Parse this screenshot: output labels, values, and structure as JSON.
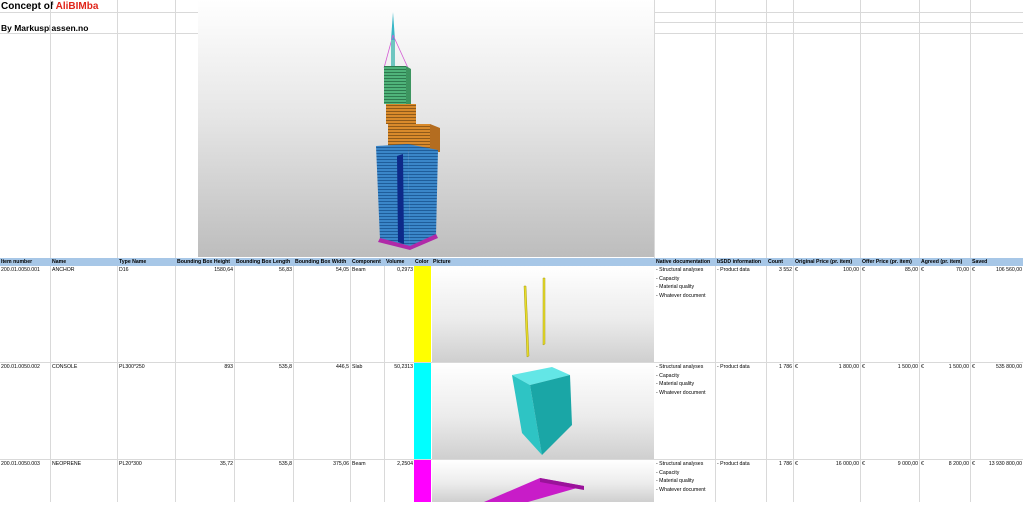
{
  "sheet": {
    "title_prefix": "Concept of ",
    "title_brand": "AliBIMba",
    "byline": "By Markusplassen.no"
  },
  "colors": {
    "header_bg": "#a7c7e7",
    "brand": "#e0251b",
    "row_colors": [
      "#ffff00",
      "#00ffff",
      "#ff00ff"
    ]
  },
  "table": {
    "columns": [
      "Item number",
      "Name",
      "Type Name",
      "Bounding Box Height",
      "Bounding Box Length",
      "Bounding Box Width",
      "Component",
      "Volume",
      "Color",
      "Picture",
      "Native documentation",
      "bSDD information",
      "Count",
      "Original Price (pr. item)",
      "Offer Price (pr. item)",
      "Agreed (pr. item)",
      "Saved"
    ],
    "rows": [
      {
        "item_number": "200.01.0050.001",
        "name": "ANCHOR",
        "type_name": "D16",
        "bb_height": "1580,64",
        "bb_length": "56,83",
        "bb_width": "54,05",
        "component": "Beam",
        "volume": "0,2973",
        "color": "#ffff00",
        "docs": [
          "- Structural analyses",
          "- Capacity",
          "- Material quality",
          "- Whatever document"
        ],
        "bsdd": "- Product data",
        "count": "3 552",
        "orig_cur": "€",
        "orig": "100,00",
        "offer_cur": "€",
        "offer": "85,00",
        "agreed_cur": "€",
        "agreed": "70,00",
        "saved_cur": "€",
        "saved": "106 560,00"
      },
      {
        "item_number": "200.01.0050.002",
        "name": "CONSOLE",
        "type_name": "PL300*250",
        "bb_height": "893",
        "bb_length": "535,8",
        "bb_width": "446,5",
        "component": "Slab",
        "volume": "50,2313",
        "color": "#00ffff",
        "docs": [
          "- Structural analyses",
          "- Capacity",
          "- Material quality",
          "- Whatever document"
        ],
        "bsdd": "- Product data",
        "count": "1 786",
        "orig_cur": "€",
        "orig": "1 800,00",
        "offer_cur": "€",
        "offer": "1 500,00",
        "agreed_cur": "€",
        "agreed": "1 500,00",
        "saved_cur": "€",
        "saved": "535 800,00"
      },
      {
        "item_number": "200.01.0050.003",
        "name": "NEOPRENE",
        "type_name": "PL20*300",
        "bb_height": "35,72",
        "bb_length": "535,8",
        "bb_width": "375,06",
        "component": "Beam",
        "volume": "2,2504",
        "color": "#ff00ff",
        "docs": [
          "- Structural analyses",
          "- Capacity",
          "- Material quality",
          "- Whatever document"
        ],
        "bsdd": "- Product data",
        "count": "1 786",
        "orig_cur": "€",
        "orig": "16 000,00",
        "offer_cur": "€",
        "offer": "9 000,00",
        "agreed_cur": "€",
        "agreed": "8 200,00",
        "saved_cur": "€",
        "saved": "13 930 800,00"
      }
    ]
  }
}
